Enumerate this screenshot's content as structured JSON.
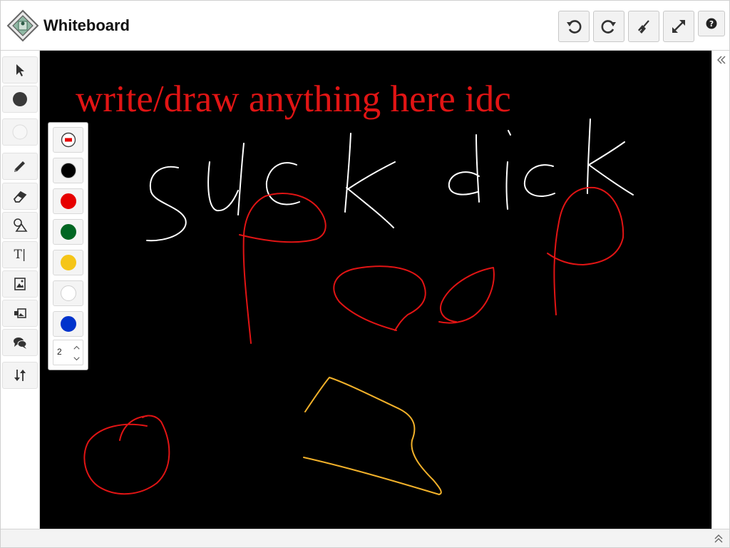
{
  "header": {
    "title": "Whiteboard",
    "buttons": [
      {
        "name": "undo-button",
        "icon": "undo-icon"
      },
      {
        "name": "redo-button",
        "icon": "redo-icon"
      },
      {
        "name": "clear-button",
        "icon": "broom-icon"
      },
      {
        "name": "fullscreen-button",
        "icon": "expand-icon"
      },
      {
        "name": "help-button",
        "icon": "question-icon"
      }
    ]
  },
  "toolbar": {
    "tools": [
      {
        "name": "select-tool",
        "icon": "cursor-icon"
      },
      {
        "name": "stroke-color-tool",
        "icon": "circle-dark-icon",
        "color": "#333333"
      },
      {
        "name": "fill-color-tool",
        "icon": "circle-light-icon",
        "color": "#f4f4f4"
      },
      {
        "name": "pencil-tool",
        "icon": "pencil-icon"
      },
      {
        "name": "eraser-tool",
        "icon": "eraser-icon"
      },
      {
        "name": "shapes-tool",
        "icon": "shapes-icon"
      },
      {
        "name": "text-tool",
        "icon": "text-icon",
        "label": "T|"
      },
      {
        "name": "image-tool",
        "icon": "image-icon"
      },
      {
        "name": "background-image-tool",
        "icon": "image-overlay-icon"
      },
      {
        "name": "comment-tool",
        "icon": "chat-icon"
      },
      {
        "name": "arrange-tool",
        "icon": "sort-arrows-icon"
      }
    ]
  },
  "color_panel": {
    "swatches": [
      {
        "name": "swatch-none",
        "color": "#ffffff",
        "icon": "no-fill-icon"
      },
      {
        "name": "swatch-black",
        "color": "#000000"
      },
      {
        "name": "swatch-red",
        "color": "#e60000"
      },
      {
        "name": "swatch-green",
        "color": "#006622"
      },
      {
        "name": "swatch-yellow",
        "color": "#f5c518"
      },
      {
        "name": "swatch-white",
        "color": "#ffffff"
      },
      {
        "name": "swatch-blue",
        "color": "#0033cc"
      }
    ],
    "line_width": "2"
  },
  "canvas": {
    "background": "#000000",
    "text": "write/draw anything here idc",
    "text_color": "#e11414",
    "stroke_colors": {
      "white": "#ffffff",
      "red": "#e11414",
      "yellow": "#f2b12a"
    }
  }
}
